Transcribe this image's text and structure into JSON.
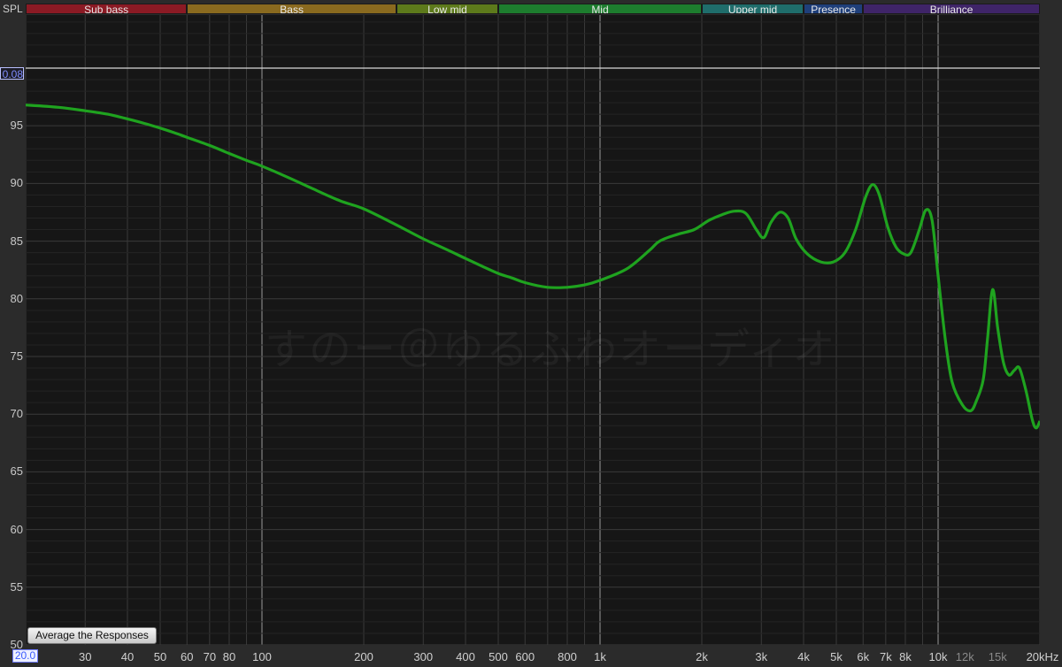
{
  "header": {
    "spl_label": "SPL"
  },
  "bands": [
    {
      "label": "Sub bass",
      "from": 20,
      "to": 60,
      "color": "#8b1a24"
    },
    {
      "label": "Bass",
      "from": 60,
      "to": 250,
      "color": "#8a6a1f"
    },
    {
      "label": "Low mid",
      "from": 250,
      "to": 500,
      "color": "#5d7a1b"
    },
    {
      "label": "Mid",
      "from": 500,
      "to": 2000,
      "color": "#1d7d2e"
    },
    {
      "label": "Upper mid",
      "from": 2000,
      "to": 4000,
      "color": "#1f6d6b"
    },
    {
      "label": "Presence",
      "from": 4000,
      "to": 6000,
      "color": "#1f3f7a"
    },
    {
      "label": "Brilliance",
      "from": 6000,
      "to": 20000,
      "color": "#3f2468"
    }
  ],
  "reference_line": {
    "label": "0.08",
    "value": 100
  },
  "start_label": "20.0",
  "watermark": "すのー＠ゆるふわオーディオ",
  "buttons": {
    "average_label": "Average the Responses"
  },
  "chart_data": {
    "type": "line",
    "xlabel": "",
    "ylabel": "SPL",
    "x_scale": "log",
    "xlim": [
      20,
      20000
    ],
    "ylim": [
      50,
      104.6
    ],
    "y_ticks": [
      {
        "value": 95,
        "label": "95"
      },
      {
        "value": 90,
        "label": "90"
      },
      {
        "value": 85,
        "label": "85"
      },
      {
        "value": 80,
        "label": "80"
      },
      {
        "value": 75,
        "label": "75"
      },
      {
        "value": 70,
        "label": "70"
      },
      {
        "value": 65,
        "label": "65"
      },
      {
        "value": 60,
        "label": "60"
      },
      {
        "value": 55,
        "label": "55"
      },
      {
        "value": 50,
        "label": "50"
      }
    ],
    "x_ticks": [
      {
        "value": 30,
        "label": "30"
      },
      {
        "value": 40,
        "label": "40"
      },
      {
        "value": 50,
        "label": "50"
      },
      {
        "value": 60,
        "label": "60"
      },
      {
        "value": 70,
        "label": "70"
      },
      {
        "value": 80,
        "label": "80"
      },
      {
        "value": 100,
        "label": "100"
      },
      {
        "value": 200,
        "label": "200"
      },
      {
        "value": 300,
        "label": "300"
      },
      {
        "value": 400,
        "label": "400"
      },
      {
        "value": 500,
        "label": "500"
      },
      {
        "value": 600,
        "label": "600"
      },
      {
        "value": 800,
        "label": "800"
      },
      {
        "value": 1000,
        "label": "1k"
      },
      {
        "value": 2000,
        "label": "2k"
      },
      {
        "value": 3000,
        "label": "3k"
      },
      {
        "value": 4000,
        "label": "4k"
      },
      {
        "value": 5000,
        "label": "5k"
      },
      {
        "value": 6000,
        "label": "6k"
      },
      {
        "value": 7000,
        "label": "7k"
      },
      {
        "value": 8000,
        "label": "8k"
      },
      {
        "value": 10000,
        "label": "10k"
      },
      {
        "value": 12000,
        "label": "12k",
        "dim": true
      },
      {
        "value": 15000,
        "label": "15k",
        "dim": true
      },
      {
        "value": 20000,
        "label": "20kHz"
      }
    ],
    "major_gridlines": [
      100,
      1000,
      10000
    ],
    "series": [
      {
        "color": "#1fa31f",
        "points": [
          [
            20,
            96.8
          ],
          [
            25,
            96.6
          ],
          [
            30,
            96.3
          ],
          [
            35,
            96.0
          ],
          [
            40,
            95.6
          ],
          [
            45,
            95.2
          ],
          [
            50,
            94.8
          ],
          [
            55,
            94.4
          ],
          [
            60,
            94.0
          ],
          [
            70,
            93.3
          ],
          [
            80,
            92.6
          ],
          [
            90,
            92.0
          ],
          [
            100,
            91.5
          ],
          [
            120,
            90.5
          ],
          [
            140,
            89.6
          ],
          [
            170,
            88.5
          ],
          [
            200,
            87.8
          ],
          [
            250,
            86.4
          ],
          [
            300,
            85.2
          ],
          [
            350,
            84.3
          ],
          [
            400,
            83.5
          ],
          [
            450,
            82.8
          ],
          [
            500,
            82.2
          ],
          [
            550,
            81.8
          ],
          [
            600,
            81.4
          ],
          [
            700,
            81.0
          ],
          [
            800,
            81.0
          ],
          [
            900,
            81.2
          ],
          [
            1000,
            81.6
          ],
          [
            1200,
            82.6
          ],
          [
            1400,
            84.2
          ],
          [
            1500,
            85.0
          ],
          [
            1700,
            85.6
          ],
          [
            1900,
            86.0
          ],
          [
            2100,
            86.8
          ],
          [
            2300,
            87.3
          ],
          [
            2500,
            87.6
          ],
          [
            2700,
            87.4
          ],
          [
            2900,
            86.0
          ],
          [
            3050,
            85.3
          ],
          [
            3200,
            86.6
          ],
          [
            3400,
            87.5
          ],
          [
            3600,
            87.0
          ],
          [
            3800,
            85.2
          ],
          [
            4100,
            83.9
          ],
          [
            4500,
            83.2
          ],
          [
            4900,
            83.2
          ],
          [
            5300,
            84.0
          ],
          [
            5700,
            86.0
          ],
          [
            6100,
            88.8
          ],
          [
            6400,
            89.9
          ],
          [
            6700,
            89.0
          ],
          [
            7100,
            86.2
          ],
          [
            7500,
            84.5
          ],
          [
            7900,
            83.9
          ],
          [
            8300,
            84.0
          ],
          [
            8800,
            86.0
          ],
          [
            9200,
            87.7
          ],
          [
            9600,
            86.8
          ],
          [
            10000,
            82.0
          ],
          [
            10500,
            76.5
          ],
          [
            11000,
            72.8
          ],
          [
            11800,
            70.8
          ],
          [
            12500,
            70.3
          ],
          [
            13000,
            71.2
          ],
          [
            13600,
            73.0
          ],
          [
            14000,
            76.5
          ],
          [
            14500,
            80.8
          ],
          [
            15000,
            77.5
          ],
          [
            15600,
            74.5
          ],
          [
            16200,
            73.4
          ],
          [
            16800,
            73.8
          ],
          [
            17400,
            74.0
          ],
          [
            18200,
            72.0
          ],
          [
            19000,
            69.5
          ],
          [
            19500,
            68.8
          ],
          [
            20000,
            69.4
          ]
        ]
      }
    ]
  }
}
